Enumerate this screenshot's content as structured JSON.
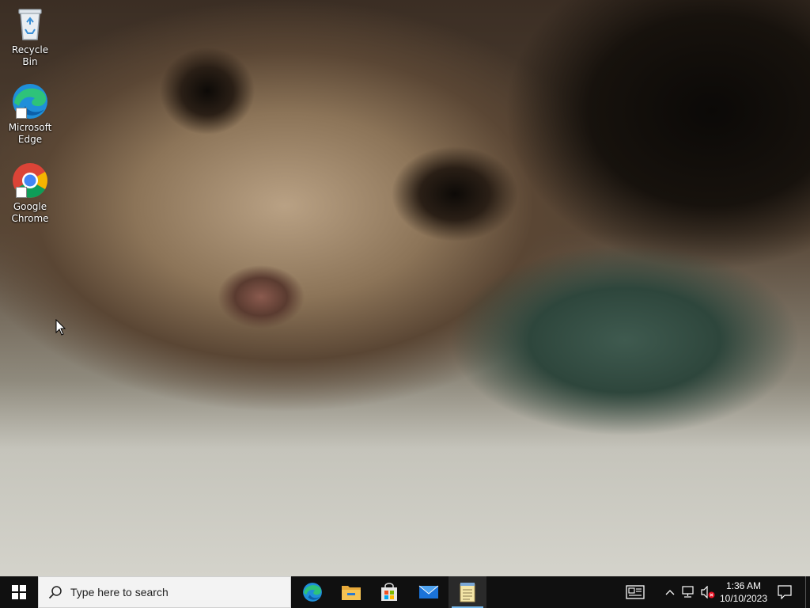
{
  "desktop": {
    "icons": [
      {
        "label": "Recycle Bin"
      },
      {
        "label": "Microsoft Edge"
      },
      {
        "label": "Google Chrome"
      }
    ]
  },
  "taskbar": {
    "search": {
      "placeholder": "Type here to search"
    },
    "apps": [
      {
        "name": "edge-icon"
      },
      {
        "name": "file-explorer-icon"
      },
      {
        "name": "microsoft-store-icon"
      },
      {
        "name": "mail-icon"
      },
      {
        "name": "notepad-icon",
        "active": true
      }
    ],
    "clock": {
      "time": "1:36 AM",
      "date": "10/10/2023"
    }
  },
  "colors": {
    "taskbar": "#101010",
    "accent": "#76b9ed"
  }
}
